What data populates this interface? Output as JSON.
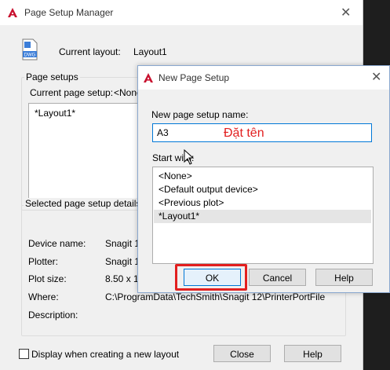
{
  "manager": {
    "title": "Page Setup Manager",
    "close": "✕",
    "dwg_label": "DWG",
    "current_layout_label": "Current layout:",
    "current_layout_value": "Layout1",
    "page_setups_label": "Page setups",
    "current_page_setup_label": "Current page setup:",
    "current_page_setup_value": "<None",
    "setups": [
      "*Layout1*"
    ],
    "details_label": "Selected page setup details",
    "details": [
      {
        "label": "Device name:",
        "value": "Snagit 1"
      },
      {
        "label": "Plotter:",
        "value": "Snagit 1"
      },
      {
        "label": "Plot size:",
        "value": "8.50 x 1"
      },
      {
        "label": "Where:",
        "value": "C:\\ProgramData\\TechSmith\\Snagit 12\\PrinterPortFile"
      },
      {
        "label": "Description:",
        "value": ""
      }
    ],
    "display_checkbox_label": "Display when creating a new layout",
    "close_button": "Close",
    "help_button": "Help"
  },
  "new_page_setup": {
    "title": "New Page Setup",
    "close": "✕",
    "name_label": "New page setup name:",
    "name_value": "A3",
    "start_with_label": "Start with:",
    "start_with_items": [
      "<None>",
      "<Default output device>",
      "<Previous plot>",
      "*Layout1*"
    ],
    "ok_button": "OK",
    "cancel_button": "Cancel",
    "help_button": "Help"
  },
  "annotation": {
    "text": "Đặt tên"
  },
  "colors": {
    "autocad_red": "#c8102e",
    "highlight_red": "#e21f1f",
    "focus_blue": "#0078d7"
  }
}
